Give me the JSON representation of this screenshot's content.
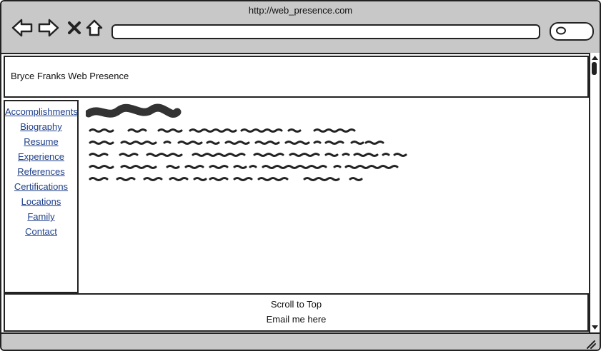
{
  "browser": {
    "url": "http://web_presence.com",
    "icons": {
      "back": "back-arrow-icon",
      "forward": "forward-arrow-icon",
      "stop": "close-icon",
      "home": "home-icon",
      "search": "search-icon",
      "resize": "resize-grip-icon"
    }
  },
  "header": {
    "title": "Bryce Franks Web Presence"
  },
  "sidebar": {
    "items": [
      {
        "label": "Accomplishments"
      },
      {
        "label": "Biography"
      },
      {
        "label": "Resume"
      },
      {
        "label": "Experience"
      },
      {
        "label": "References"
      },
      {
        "label": "Certifications"
      },
      {
        "label": "Locations"
      },
      {
        "label": "Family"
      },
      {
        "label": "Contact"
      }
    ]
  },
  "footer": {
    "scroll_to_top": "Scroll to Top",
    "email": "Email me here"
  },
  "colors": {
    "chrome": "#c8c8c8",
    "link": "#1e3f8a",
    "stroke": "#222222"
  }
}
